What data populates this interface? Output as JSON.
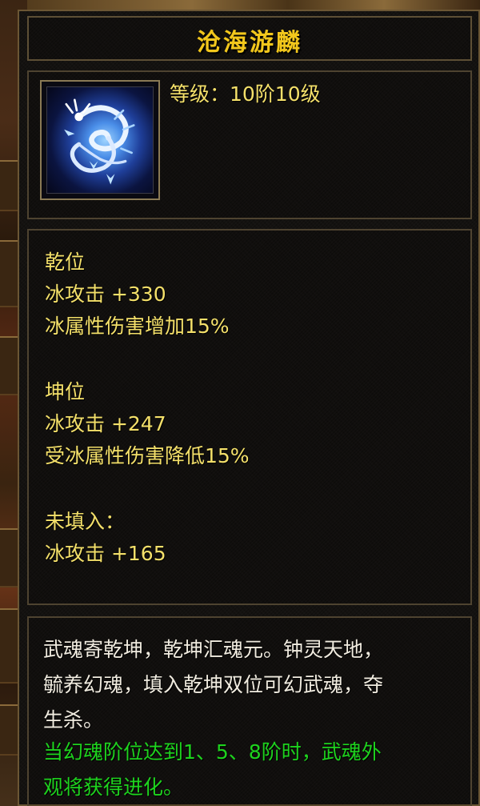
{
  "item": {
    "name": "沧海游麟",
    "level_text": "等级：10阶10级",
    "icon": "ice-dragon-icon"
  },
  "attributes": {
    "qian": {
      "heading": "乾位",
      "lines": [
        "冰攻击 +330",
        "冰属性伤害增加15%"
      ]
    },
    "kun": {
      "heading": "坤位",
      "lines": [
        "冰攻击 +247",
        "受冰属性伤害降低15%"
      ]
    },
    "unfilled": {
      "heading": "未填入：",
      "lines": [
        "冰攻击 +165"
      ]
    }
  },
  "description": {
    "lines": [
      "武魂寄乾坤，乾坤汇魂元。钟灵天地，",
      "毓养幻魂，填入乾坤双位可幻武魂，夺",
      "生杀。"
    ],
    "highlight_lines": [
      "当幻魂阶位达到1、5、8阶时，武魂外",
      "观将获得进化。"
    ]
  },
  "colors": {
    "title": "#f2c71c",
    "attribute_text": "#f4e06a",
    "description_text": "#f1ece0",
    "highlight_text": "#1ed31e",
    "border": "#6b5634"
  }
}
